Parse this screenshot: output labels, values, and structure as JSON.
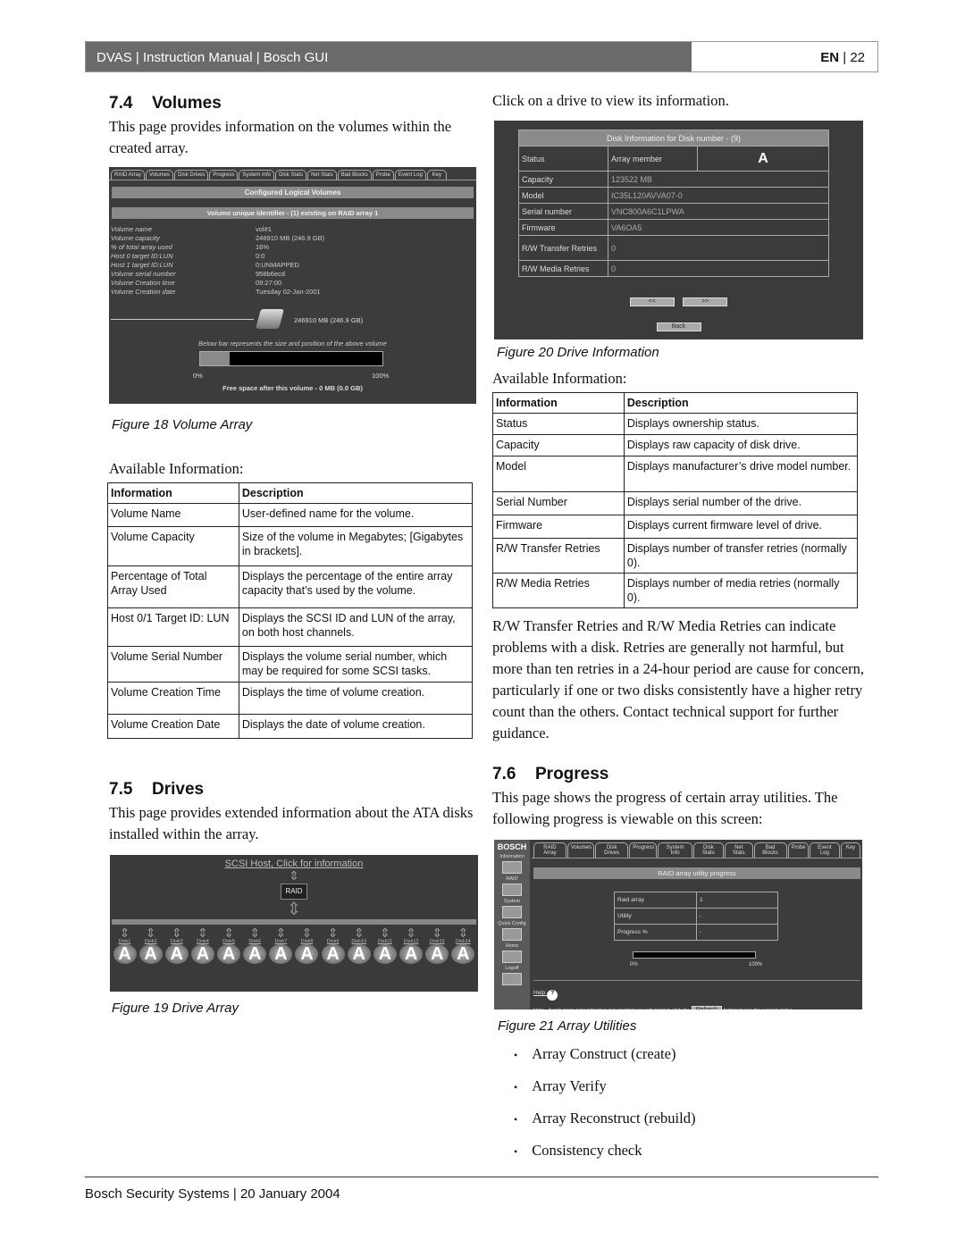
{
  "header": {
    "left": "DVAS | Instruction Manual | Bosch GUI",
    "lang": "EN",
    "page": "22"
  },
  "s74": {
    "num": "7.4",
    "title": "Volumes",
    "intro": "This page provides information on the volumes within the created array.",
    "figure": {
      "tabs": [
        "RAID Array",
        "Volumes",
        "Disk Drives",
        "Progress",
        "System Info",
        "Disk Stats",
        "Net Stats",
        "Bad Blocks",
        "Probe",
        "Event Log",
        "Key"
      ],
      "bar1": "Configured Logical Volumes",
      "bar2": "Volume unique identifier - (1) existing on RAID array 1",
      "rows": [
        {
          "k": "Volume name",
          "v": "vol#1"
        },
        {
          "k": "Volume capacity",
          "v": "246910 MB (246.9 GB)"
        },
        {
          "k": "% of total array used",
          "v": "16%"
        },
        {
          "k": "Host 0 target ID:LUN",
          "v": "0:0"
        },
        {
          "k": "Host 1 target ID:LUN",
          "v": "0:UNMAPPED"
        },
        {
          "k": "Volume serial number",
          "v": "958b6ecd"
        },
        {
          "k": "Volume Creation time",
          "v": "09:27:00"
        },
        {
          "k": "Volume Creation date",
          "v": "Tuesday 02-Jan-2001"
        }
      ],
      "vol_size": "246910 MB (246.9 GB)",
      "bar_caption": "Below bar represents the size and position of the above volume",
      "bar_used_fraction": 0.16,
      "bar_min": "0%",
      "bar_max": "100%",
      "free": "Free space after this volume - 0 MB (0.0 GB)"
    },
    "caption": "Figure 18  Volume Array",
    "avail": "Available Information:",
    "table": {
      "headers": [
        "Information",
        "Description"
      ],
      "rows": [
        [
          "Volume Name",
          "User-defined name for the volume."
        ],
        [
          "Volume Capacity",
          "Size of the volume in Megabytes; [Gigabytes in brackets]."
        ],
        [
          "Percentage of Total Array Used",
          "Displays the percentage of the entire array capacity that’s used by the volume."
        ],
        [
          "Host 0/1 Target ID: LUN",
          "Displays the SCSI ID and LUN of the array, on both host channels."
        ],
        [
          "Volume Serial Number",
          "Displays the volume serial number, which may be required for some SCSI tasks."
        ],
        [
          "Volume Creation Time",
          "Displays the time of volume creation."
        ],
        [
          "Volume Creation Date",
          "Displays the date of volume creation."
        ]
      ]
    }
  },
  "s75": {
    "num": "7.5",
    "title": "Drives",
    "intro": "This page provides extended information about the ATA disks installed within the array.",
    "figure": {
      "host_link": "SCSI Host, Click for information",
      "raid_label": "RAID",
      "disks": [
        "Disk1",
        "Disk2",
        "Disk3",
        "Disk4",
        "Disk5",
        "Disk6",
        "Disk7",
        "Disk8",
        "Disk9",
        "Disk10",
        "Disk11",
        "Disk12",
        "Disk13",
        "Disk14"
      ],
      "disk_status_glyph": "A"
    },
    "caption": "Figure 19  Drive Array"
  },
  "drive_info": {
    "intro": "Click on a drive to view its information.",
    "figure": {
      "title": "Disk Information for Disk number - (9)",
      "rows": [
        {
          "k": "Status",
          "v": "Array member"
        },
        {
          "k": "Capacity",
          "v": "123522 MB"
        },
        {
          "k": "Model",
          "v": "IC35L120AVVA07-0"
        },
        {
          "k": "Serial number",
          "v": "VNC800A6C1LPWA"
        },
        {
          "k": "Firmware",
          "v": "VA6OA5"
        },
        {
          "k": "R/W Transfer Retries",
          "v": "0"
        },
        {
          "k": "R/W Media Retries",
          "v": "0"
        }
      ],
      "status_glyph": "A",
      "prev": "<<",
      "next": ">>",
      "back": "Back"
    },
    "caption": "Figure 20  Drive Information",
    "avail": "Available Information:",
    "table": {
      "headers": [
        "Information",
        "Description"
      ],
      "rows": [
        [
          "Status",
          "Displays ownership status."
        ],
        [
          "Capacity",
          "Displays raw capacity of disk drive."
        ],
        [
          "Model",
          "Displays manufacturer’s drive model number."
        ],
        [
          "Serial Number",
          "Displays serial number of the drive."
        ],
        [
          "Firmware",
          "Displays current firmware level of drive."
        ],
        [
          "R/W Transfer Retries",
          "Displays number of transfer retries (normally 0)."
        ],
        [
          "R/W Media Retries",
          "Displays number of media retries (normally 0)."
        ]
      ]
    },
    "note": "R/W Transfer Retries and R/W Media Retries can indicate problems with a disk. Retries are generally not harmful, but more than ten retries in a 24-hour period are cause for concern, particularly if one or two disks consistently have a higher retry count than the others. Contact technical support for further guidance."
  },
  "s76": {
    "num": "7.6",
    "title": "Progress",
    "intro": "This page shows the progress of certain array utilities. The following progress is viewable on this screen:",
    "figure": {
      "brand": "BOSCH",
      "side": [
        "Information",
        "RAID",
        "System",
        "Quick Config",
        "Home",
        "Logoff"
      ],
      "tabs": [
        "RAID Array",
        "Volumes",
        "Disk Drives",
        "Progress",
        "System Info",
        "Disk Stats",
        "Net Stats",
        "Bad Blocks",
        "Probe",
        "Event Log",
        "Key"
      ],
      "bar": "RAID array utility progress",
      "rows": [
        {
          "k": "Raid array",
          "v": "1"
        },
        {
          "k": "Utility",
          "v": "-"
        },
        {
          "k": "Progress %",
          "v": "-"
        }
      ],
      "progress_fraction": 0,
      "min": "0%",
      "max": "100%",
      "help": "Help",
      "note_pre": "Note - if web page auto refresh is not enabled you will need to click the",
      "refresh": "Refresh",
      "note_post": "button to see the current status."
    },
    "caption": "Figure 21  Array Utilities",
    "bullets": [
      "Array Construct (create)",
      "Array Verify",
      "Array Reconstruct (rebuild)",
      "Consistency check"
    ]
  },
  "footer": "Bosch Security Systems | 20 January 2004"
}
